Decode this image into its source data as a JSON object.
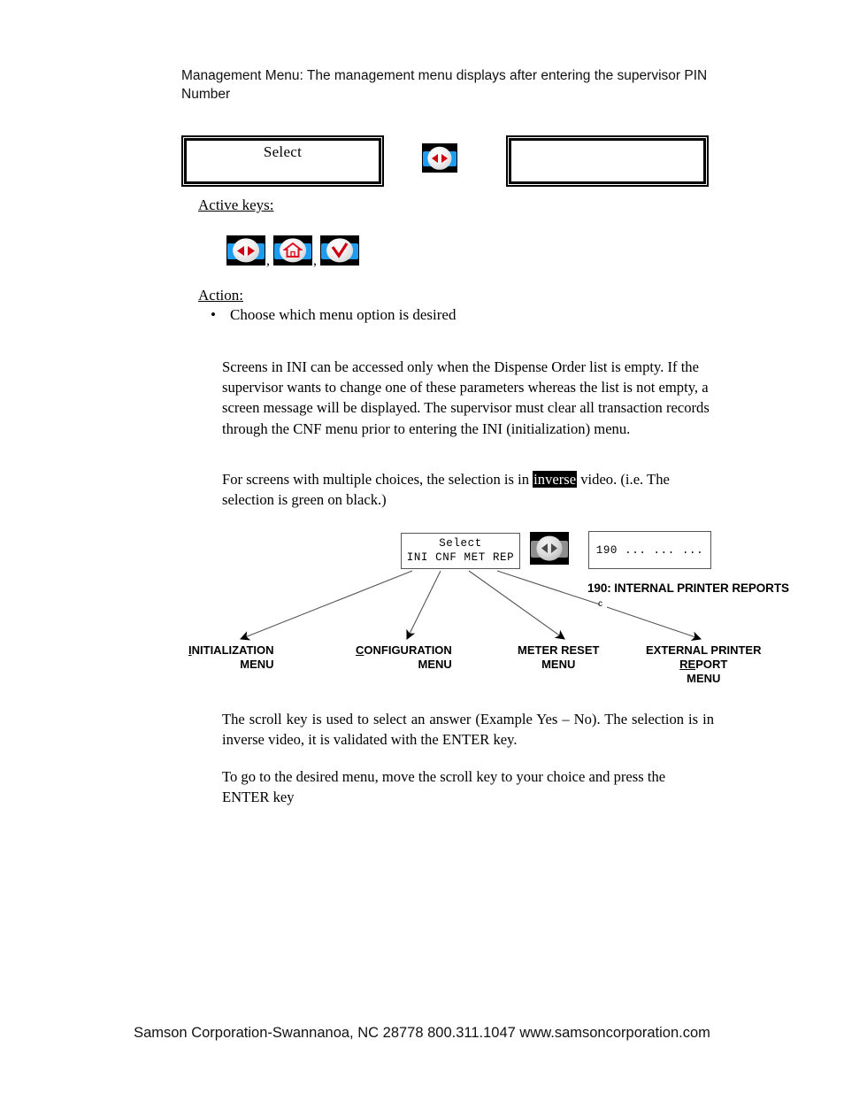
{
  "document": {
    "intro": "Management Menu:  The management menu displays after entering the supervisor PIN Number"
  },
  "top_row": {
    "display_left_text": "Select",
    "display_right_text": "",
    "scroll_icon_name": "scroll-key-icon"
  },
  "active_keys": {
    "label": "Active keys:",
    "separator": ",",
    "keys": [
      {
        "name": "scroll-key-icon",
        "label": "scroll key"
      },
      {
        "name": "home-key-icon",
        "label": "home key"
      },
      {
        "name": "enter-key-icon",
        "label": "enter key"
      }
    ]
  },
  "action": {
    "label": "Action:",
    "bullet_glyph": "•",
    "items": [
      "Choose which menu option is desired"
    ]
  },
  "paragraphs": {
    "ini_access": "Screens in INI can be accessed only when the Dispense Order list is empty. If the supervisor wants to change one of these parameters whereas the list is not empty, a screen message will be displayed.  The supervisor must clear all transaction records through the CNF menu prior to entering the INI (initialization) menu.",
    "inverse_part1": "For screens with multiple choices, the selection is in ",
    "inverse_highlight": "inverse",
    "inverse_part2": " video.  (i.e. The selection is green on black.)",
    "scroll_key": "The scroll key is used to select an answer (Example Yes – No). The selection is in inverse video, it is validated with the ENTER key.",
    "goto_menu": "To go to the desired menu, move the scroll key to your choice and press the ENTER key"
  },
  "diagram": {
    "menu_display": {
      "line1": "Select",
      "line2": "INI CNF MET REP"
    },
    "scroll_icon_name": "scroll-key-icon-gray",
    "report_display": {
      "text": "190 ... ... ..."
    },
    "report_caption": "190: INTERNAL PRINTER REPORTS",
    "connector_marker": "c",
    "leaves": [
      {
        "line1_underlined": "I",
        "line1_rest": "NITIALIZATION",
        "line2": "MENU",
        "line3": ""
      },
      {
        "line1_underlined": "C",
        "line1_rest": "ONFIGURATION",
        "line2": "MENU",
        "line3": ""
      },
      {
        "line1_underlined": "",
        "line1_rest": "METER RESET",
        "line2": "MENU",
        "line3": ""
      },
      {
        "line1_underlined": "",
        "line1_rest": "EXTERNAL PRINTER",
        "line2": "REPORT",
        "line3": "MENU"
      }
    ]
  },
  "footer": {
    "text": "Samson Corporation-Swannanoa, NC 28778  800.311.1047 www.samsoncorporation.com"
  },
  "colors": {
    "key_band_blue": "#1f9cf0",
    "key_arrow_red": "#cc0011",
    "key_bg_black": "#000000",
    "highlight_black": "#000000"
  }
}
